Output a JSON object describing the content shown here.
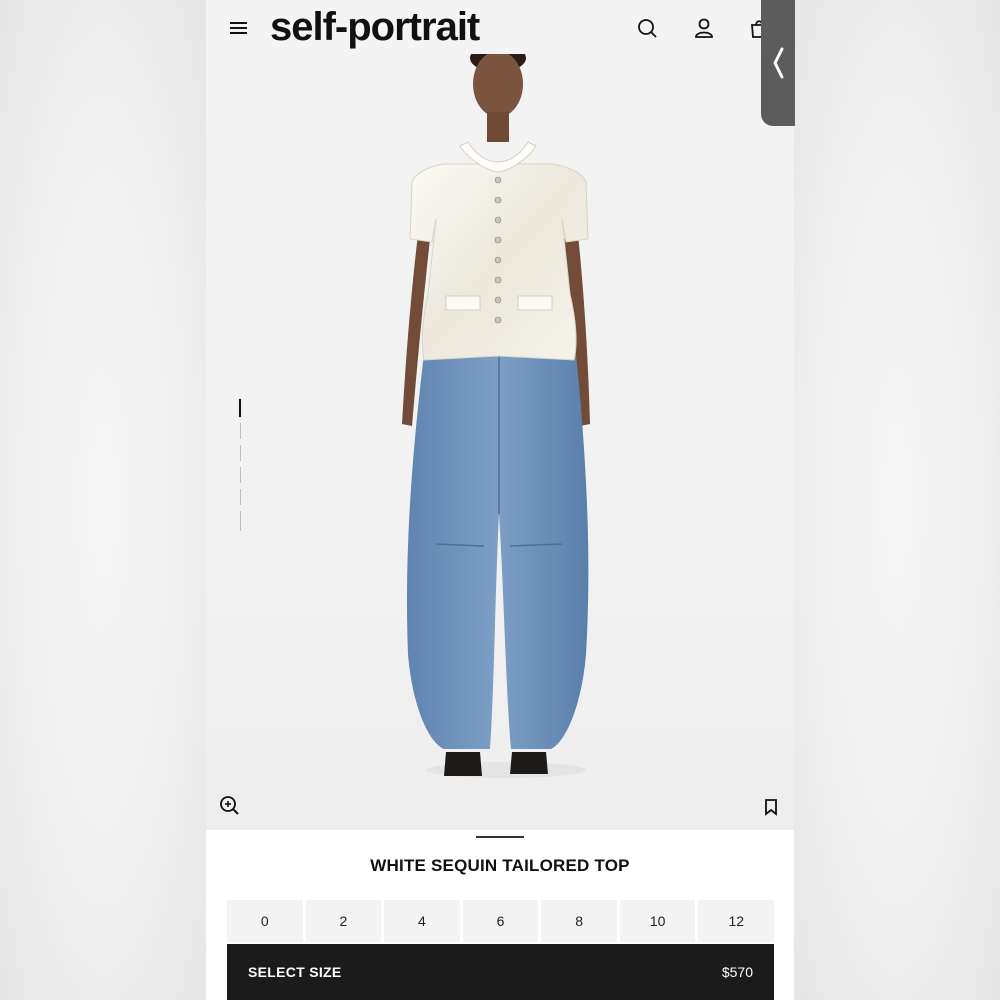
{
  "header": {
    "brand": "self-portrait",
    "icons": [
      "menu-icon",
      "search-icon",
      "account-icon",
      "bag-icon"
    ]
  },
  "gallery": {
    "image_description": "Model wearing white sequin short-sleeve tailored top with jeweled buttons and wide-leg blue denim jeans, black strappy sandals",
    "pager_count": 6,
    "pager_active": 1
  },
  "product": {
    "title": "WHITE SEQUIN TAILORED TOP",
    "sizes": [
      "0",
      "2",
      "4",
      "6",
      "8",
      "10",
      "12"
    ],
    "cta_label": "SELECT SIZE",
    "price": "$570"
  },
  "colors": {
    "text": "#111111",
    "cta_bg": "#1b1b1b",
    "size_bg": "#f3f3f3",
    "denim": "#6b8fb8",
    "top": "#f2efe6"
  }
}
